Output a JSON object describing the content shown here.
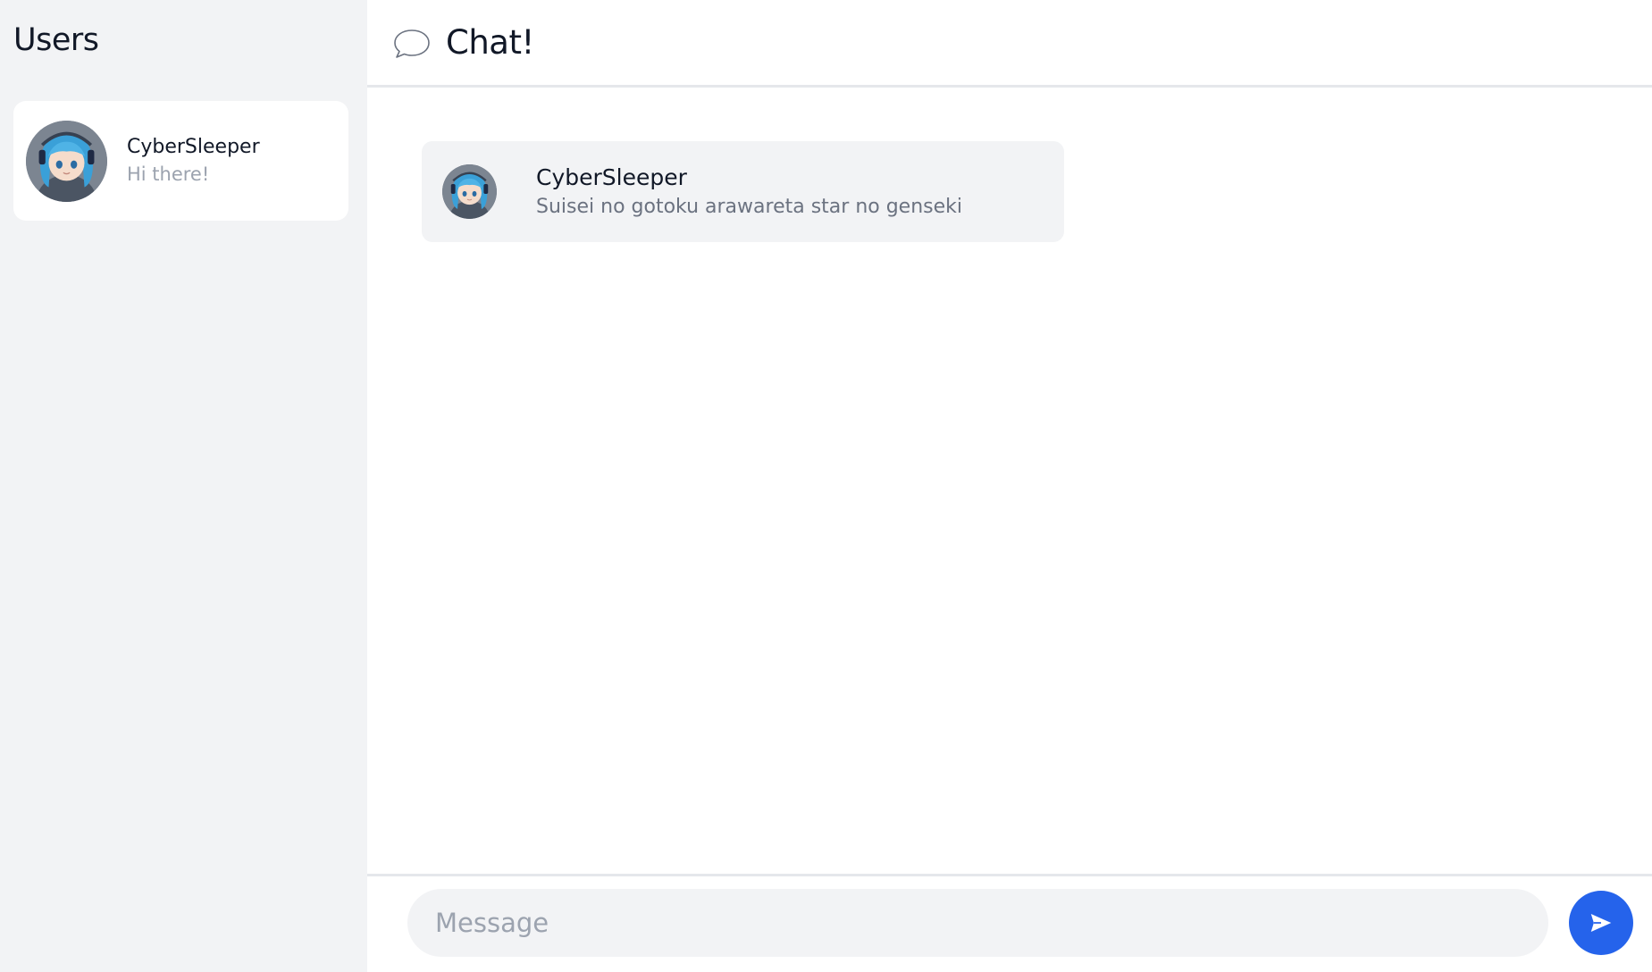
{
  "sidebar": {
    "title": "Users",
    "users": [
      {
        "name": "CyberSleeper",
        "preview": "Hi there!",
        "avatar_icon": "user-avatar"
      }
    ]
  },
  "header": {
    "icon": "chat-bubble-icon",
    "title": "Chat!"
  },
  "messages": [
    {
      "author": "CyberSleeper",
      "text": "Suisei no gotoku arawareta star no genseki",
      "avatar_icon": "user-avatar"
    }
  ],
  "composer": {
    "placeholder": "Message",
    "value": "",
    "send_icon": "send-icon"
  },
  "colors": {
    "sidebar_bg": "#f2f3f5",
    "accent": "#2563eb",
    "muted_text": "#9ca3af",
    "secondary_text": "#6b7280",
    "divider": "#e5e7eb"
  }
}
